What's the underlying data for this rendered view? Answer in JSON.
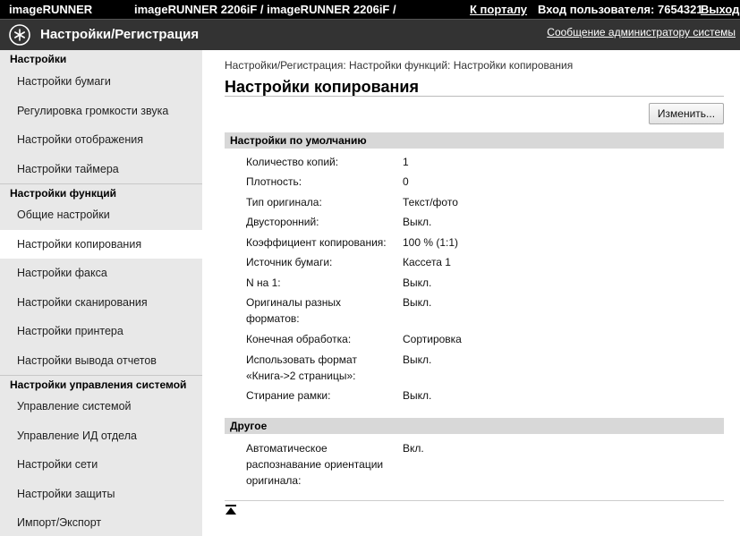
{
  "topbar": {
    "product": "imageRUNNER",
    "model": "imageRUNNER 2206iF / imageRUNNER 2206iF /",
    "portal_link": "К порталу",
    "user_login": "Вход пользователя: 7654321",
    "logout": "Выход"
  },
  "titlebar": {
    "title": "Настройки/Регистрация",
    "admin_message": "Сообщение администратору системы"
  },
  "sidebar": {
    "sections": [
      {
        "title": "Настройки",
        "items": [
          "Настройки бумаги",
          "Регулировка громкости звука",
          "Настройки отображения",
          "Настройки таймера"
        ]
      },
      {
        "title": "Настройки функций",
        "items": [
          "Общие настройки",
          "Настройки копирования",
          "Настройки факса",
          "Настройки сканирования",
          "Настройки принтера",
          "Настройки вывода отчетов"
        ]
      },
      {
        "title": "Настройки управления системой",
        "items": [
          "Управление системой",
          "Управление ИД отдела",
          "Настройки сети",
          "Настройки защиты",
          "Импорт/Экспорт"
        ]
      }
    ],
    "active_item": "Настройки копирования"
  },
  "main": {
    "breadcrumb": "Настройки/Регистрация: Настройки функций: Настройки копирования",
    "title": "Настройки копирования",
    "edit_button": "Изменить...",
    "groups": [
      {
        "title": "Настройки по умолчанию",
        "rows": [
          {
            "label": "Количество копий:",
            "value": "1"
          },
          {
            "label": "Плотность:",
            "value": "0"
          },
          {
            "label": "Тип оригинала:",
            "value": "Текст/фото"
          },
          {
            "label": "Двусторонний:",
            "value": "Выкл."
          },
          {
            "label": "Коэффициент копирования:",
            "value": "100 % (1:1)"
          },
          {
            "label": "Источник бумаги:",
            "value": "Кассета 1"
          },
          {
            "label": "N на 1:",
            "value": "Выкл."
          },
          {
            "label": "Оригиналы разных форматов:",
            "value": "Выкл."
          },
          {
            "label": "Конечная обработка:",
            "value": "Сортировка"
          },
          {
            "label": "Использовать формат «Книга->2 страницы»:",
            "value": "Выкл."
          },
          {
            "label": "Стирание рамки:",
            "value": "Выкл."
          }
        ]
      },
      {
        "title": "Другое",
        "rows": [
          {
            "label": "Автоматическое распознавание ориентации оригинала:",
            "value": "Вкл."
          }
        ]
      }
    ]
  },
  "icons": {
    "logo": "canon-settings-logo-icon",
    "back_to_top": "back-to-top-icon"
  }
}
